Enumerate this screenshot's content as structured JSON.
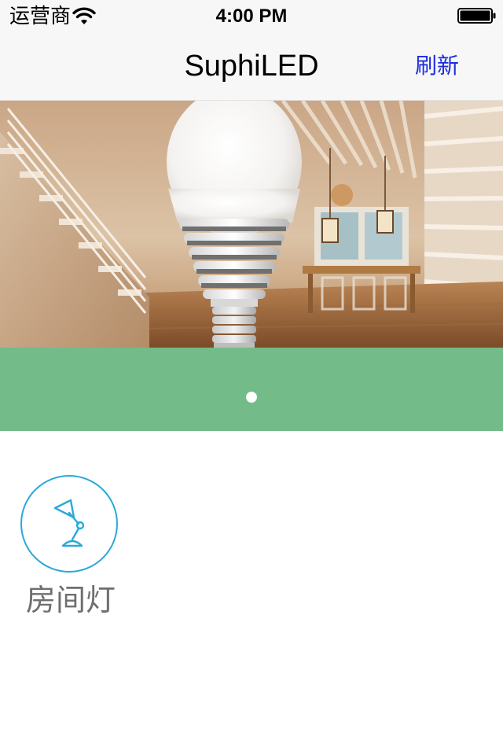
{
  "status_bar": {
    "carrier": "运营商",
    "time": "4:00 PM",
    "wifi_icon": "wifi-icon",
    "battery_icon": "battery-full-icon",
    "battery_level": 1.0
  },
  "nav": {
    "title": "SuphiLED",
    "refresh_label": "刷新"
  },
  "banner": {
    "image": "led-bulb-interior-photo",
    "page_count": 1,
    "current_page": 1
  },
  "devices": [
    {
      "label": "房间灯",
      "icon": "desk-lamp-icon"
    }
  ],
  "colors": {
    "pager_background": "#73bb88",
    "accent_blue": "#1a2be0",
    "device_ring": "#2aa9d8",
    "device_label": "#6f6f6f"
  }
}
